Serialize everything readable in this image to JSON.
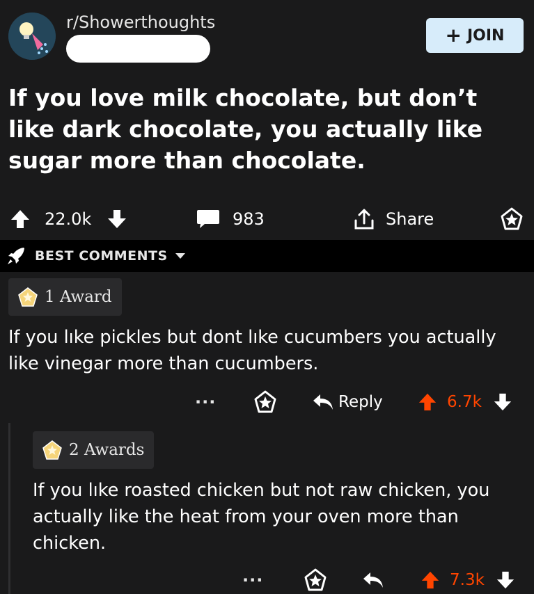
{
  "subreddit": {
    "name": "r/Showerthoughts"
  },
  "header": {
    "join_label": "JOIN"
  },
  "post": {
    "title": "If you love milk chocolate, but don’t like dark chocolate, you actually like sugar more than chocolate.",
    "upvotes": "22.0k",
    "comments_count": "983",
    "share_label": "Share"
  },
  "sort": {
    "label": "BEST COMMENTS"
  },
  "comments": [
    {
      "award_label": "1 Award",
      "text": "If you lıke pickles but dont lıke cucumbers you actually like vinegar more than cucumbers.",
      "dots": "···",
      "reply_label": "Reply",
      "score": "6.7k"
    },
    {
      "award_label": "2 Awards",
      "text": "If you lıke roasted chicken but not raw chicken, you actually like the heat from your oven more than chicken.",
      "dots": "···",
      "score": "7.3k"
    }
  ],
  "colors": {
    "background": "#1a1a1b",
    "join_bg": "#d7ecfa",
    "upvote_accent": "#ff4500",
    "sort_bar_bg": "#000000"
  },
  "icons": {
    "subreddit_avatar": "showerhead-lightbulb-icon",
    "upvote": "arrow-up-icon",
    "downvote": "arrow-down-icon",
    "comment": "speech-bubble-icon",
    "share": "share-arrow-icon",
    "award": "award-star-icon",
    "sort": "rocket-icon",
    "reply": "reply-arrow-icon"
  }
}
